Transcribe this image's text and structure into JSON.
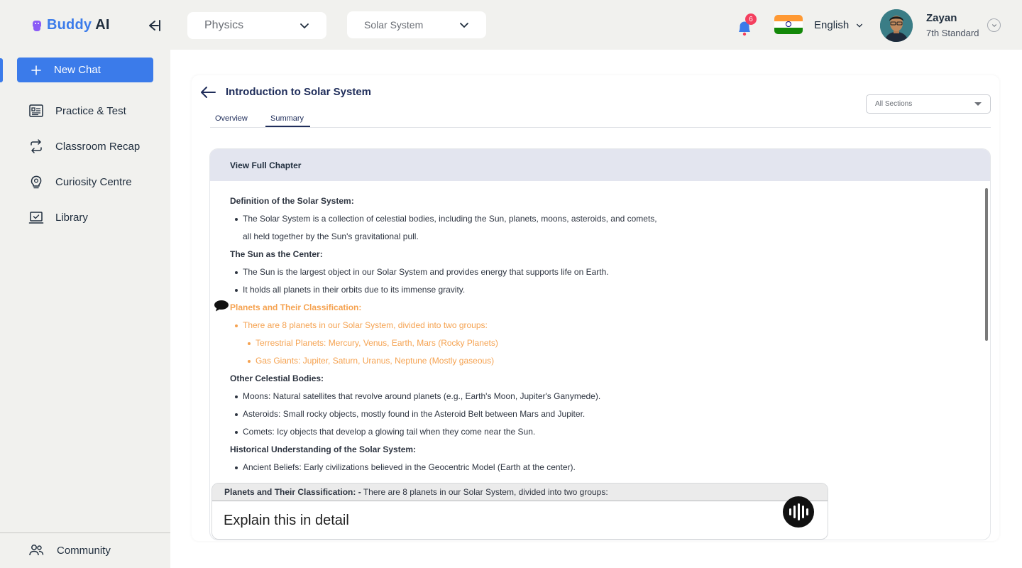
{
  "brand": {
    "name_part1": "Buddy",
    "name_part2": "AI",
    "accent": "#3b7bea",
    "logo_color": "#8b5cf6"
  },
  "header": {
    "subject": "Physics",
    "topic": "Solar System",
    "notifications_count": "6",
    "language": "English",
    "user": {
      "name": "Zayan",
      "grade": "7th Standard"
    }
  },
  "sidebar": {
    "new_chat": "New Chat",
    "items": [
      {
        "label": "Practice & Test",
        "icon": "practice-test-icon"
      },
      {
        "label": "Classroom Recap",
        "icon": "recap-icon"
      },
      {
        "label": "Curiosity Centre",
        "icon": "curiosity-icon"
      },
      {
        "label": "Library",
        "icon": "library-icon"
      }
    ],
    "community": "Community"
  },
  "page": {
    "title": "Introduction to Solar System",
    "tabs": [
      "Overview",
      "Summary"
    ],
    "active_tab": "Summary",
    "sections_filter": "All Sections",
    "chapter_header": "View Full Chapter"
  },
  "content": [
    {
      "type": "heading",
      "text": "Definition of the Solar System:"
    },
    {
      "type": "bullet",
      "text": "The Solar System is a collection of celestial bodies, including the Sun, planets, moons, asteroids, and comets,"
    },
    {
      "type": "cont",
      "text": "all held together by the Sun's gravitational pull."
    },
    {
      "type": "heading",
      "text": "The Sun as the Center:"
    },
    {
      "type": "bullet",
      "text": "The Sun is the largest object in our Solar System and provides energy that supports life on Earth."
    },
    {
      "type": "bullet",
      "text": "It holds all planets in their orbits due to its immense gravity."
    },
    {
      "type": "heading",
      "text": "Planets and Their Classification:",
      "highlight": true
    },
    {
      "type": "bullet",
      "text": "There are 8 planets in our Solar System, divided into two groups:",
      "highlight": true
    },
    {
      "type": "sub",
      "text": "Terrestrial Planets: Mercury, Venus, Earth, Mars (Rocky Planets)",
      "highlight": true
    },
    {
      "type": "sub",
      "text": "Gas Giants: Jupiter, Saturn, Uranus, Neptune (Mostly gaseous)",
      "highlight": true
    },
    {
      "type": "heading",
      "text": "Other Celestial Bodies:"
    },
    {
      "type": "bullet",
      "text": "Moons: Natural satellites that revolve around planets (e.g., Earth's Moon, Jupiter's Ganymede)."
    },
    {
      "type": "bullet",
      "text": "Asteroids: Small rocky objects, mostly found in the Asteroid Belt between Mars and Jupiter."
    },
    {
      "type": "bullet",
      "text": "Comets: Icy objects that develop a glowing tail when they come near the Sun."
    },
    {
      "type": "heading",
      "text": "Historical Understanding of the Solar System:"
    },
    {
      "type": "bullet",
      "text": "Ancient Beliefs: Early civilizations believed in the Geocentric Model (Earth at the center)."
    }
  ],
  "ask": {
    "context_label": "Planets and Their Classification: -",
    "context_text": "There are 8 planets in our Solar System, divided into two groups:",
    "input_value": "Explain this in detail"
  },
  "colors": {
    "highlight": "#f5a250",
    "chapter_header_bg": "#e3e5ef",
    "badge": "#f43f5e"
  }
}
